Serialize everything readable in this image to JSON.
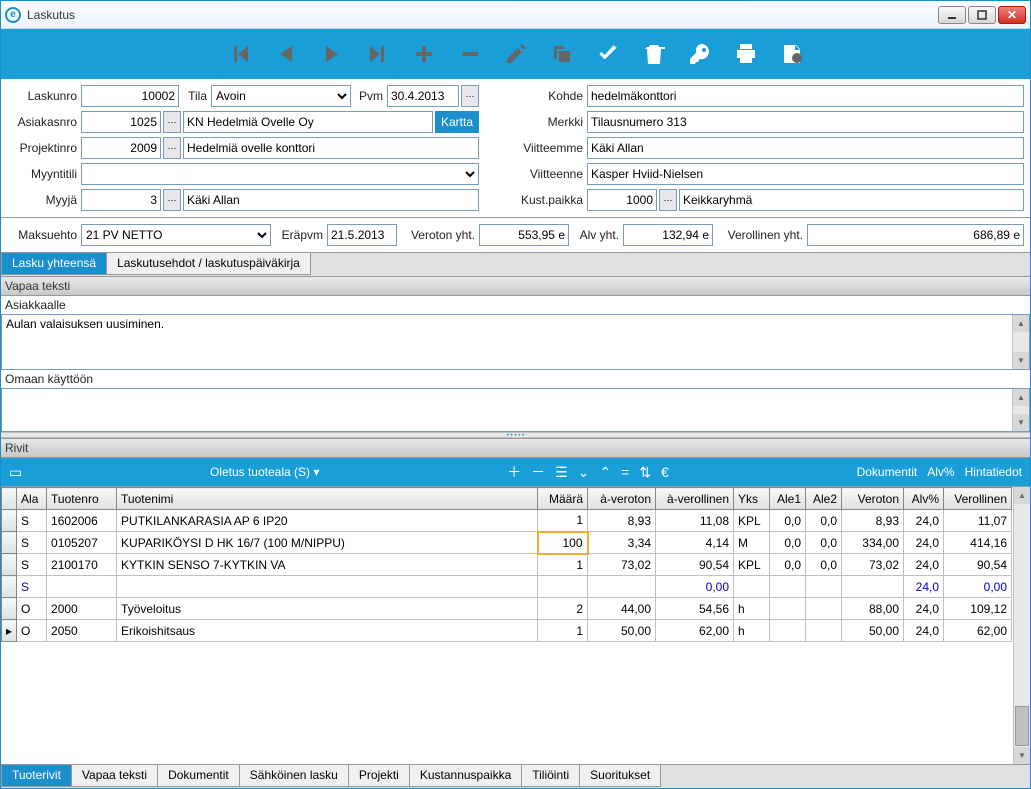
{
  "window": {
    "title": "Laskutus",
    "app_icon": "e"
  },
  "form": {
    "laskunro": {
      "label": "Laskunro",
      "value": "10002"
    },
    "tila": {
      "label": "Tila",
      "value": "Avoin"
    },
    "pvm": {
      "label": "Pvm",
      "value": "30.4.2013"
    },
    "kohde": {
      "label": "Kohde",
      "value": "hedelmäkonttori"
    },
    "asiakasnro": {
      "label": "Asiakasnro",
      "value": "1025",
      "name": "KN Hedelmiä Ovelle Oy"
    },
    "kartta": "Kartta",
    "merkki": {
      "label": "Merkki",
      "value": "Tilausnumero 313"
    },
    "projektinro": {
      "label": "Projektinro",
      "value": "2009",
      "name": "Hedelmiä ovelle konttori"
    },
    "viitteemme": {
      "label": "Viitteemme",
      "value": "Käki Allan"
    },
    "myyntitili": {
      "label": "Myyntitili",
      "value": ""
    },
    "viitteenne": {
      "label": "Viitteenne",
      "value": "Kasper Hviid-Nielsen"
    },
    "myyja": {
      "label": "Myyjä",
      "value": "3",
      "name": "Käki Allan"
    },
    "kustpaikka": {
      "label": "Kust.paikka",
      "value": "1000",
      "name": "Keikkaryhmä"
    },
    "maksuehto": {
      "label": "Maksuehto",
      "value": "21 PV NETTO"
    },
    "erapvm": {
      "label": "Eräpvm",
      "value": "21.5.2013"
    },
    "veroton_yht": {
      "label": "Veroton yht.",
      "value": "553,95 e"
    },
    "alv_yht": {
      "label": "Alv yht.",
      "value": "132,94 e"
    },
    "verollinen_yht": {
      "label": "Verollinen yht.",
      "value": "686,89 e"
    }
  },
  "mid_tabs": {
    "t1": "Lasku yhteensä",
    "t2": "Laskutusehdot / laskutuspäiväkirja"
  },
  "free_text": {
    "header": "Vapaa teksti",
    "asiakkaalle_label": "Asiakkaalle",
    "asiakkaalle_value": "Aulan valaisuksen uusiminen.",
    "omaan_label": "Omaan käyttöön",
    "omaan_value": ""
  },
  "rows": {
    "header": "Rivit",
    "toolbar": {
      "default_area": "Oletus tuoteala (S)",
      "dokumentit": "Dokumentit",
      "alv": "Alv%",
      "hintatiedot": "Hintatiedot"
    },
    "columns": [
      "Ala",
      "Tuotenro",
      "Tuotenimi",
      "Määrä",
      "à-veroton",
      "à-verollinen",
      "Yks",
      "Ale1",
      "Ale2",
      "Veroton",
      "Alv%",
      "Verollinen"
    ],
    "data": [
      {
        "ala": "S",
        "tuotenro": "1602006",
        "tuotenimi": "PUTKILANKARASIA AP 6 IP20",
        "maara": "1",
        "averoton": "8,93",
        "averollinen": "11,08",
        "yks": "KPL",
        "ale1": "0,0",
        "ale2": "0,0",
        "veroton": "8,93",
        "alv": "24,0",
        "verollinen": "11,07"
      },
      {
        "ala": "S",
        "tuotenro": "0105207",
        "tuotenimi": "KUPARIKÖYSI D HK 16/7 (100 M/NIPPU)",
        "maara": "100",
        "averoton": "3,34",
        "averollinen": "4,14",
        "yks": "M",
        "ale1": "0,0",
        "ale2": "0,0",
        "veroton": "334,00",
        "alv": "24,0",
        "verollinen": "414,16",
        "selected": true
      },
      {
        "ala": "S",
        "tuotenro": "2100170",
        "tuotenimi": "KYTKIN SENSO 7-KYTKIN VA",
        "maara": "1",
        "averoton": "73,02",
        "averollinen": "90,54",
        "yks": "KPL",
        "ale1": "0,0",
        "ale2": "0,0",
        "veroton": "73,02",
        "alv": "24,0",
        "verollinen": "90,54"
      },
      {
        "ala": "S",
        "tuotenro": "",
        "tuotenimi": "",
        "maara": "",
        "averoton": "",
        "averollinen": "0,00",
        "yks": "",
        "ale1": "",
        "ale2": "",
        "veroton": "",
        "alv": "24,0",
        "verollinen": "0,00",
        "blue": true
      },
      {
        "ala": "O",
        "tuotenro": "2000",
        "tuotenimi": "Työveloitus",
        "maara": "2",
        "averoton": "44,00",
        "averollinen": "54,56",
        "yks": "h",
        "ale1": "",
        "ale2": "",
        "veroton": "88,00",
        "alv": "24,0",
        "verollinen": "109,12"
      },
      {
        "ala": "O",
        "tuotenro": "2050",
        "tuotenimi": "Erikoishitsaus",
        "maara": "1",
        "averoton": "50,00",
        "averollinen": "62,00",
        "yks": "h",
        "ale1": "",
        "ale2": "",
        "veroton": "50,00",
        "alv": "24,0",
        "verollinen": "62,00",
        "current": true
      }
    ]
  },
  "bottom_tabs": [
    "Tuoterivit",
    "Vapaa teksti",
    "Dokumentit",
    "Sähköinen lasku",
    "Projekti",
    "Kustannuspaikka",
    "Tiliöinti",
    "Suoritukset"
  ]
}
